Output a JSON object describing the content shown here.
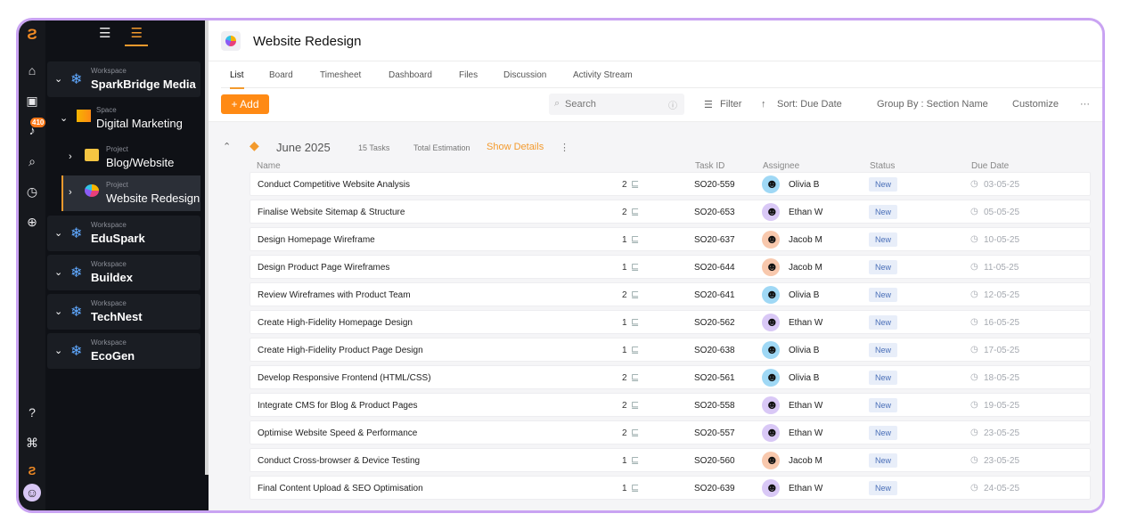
{
  "app": {
    "notifications": "410"
  },
  "sidebar_tabs": {
    "list_icon": "list-icon",
    "tree_icon": "tree-icon"
  },
  "tree": {
    "workspaces": [
      {
        "caption": "Workspace",
        "name": "SparkBridge Media"
      },
      {
        "caption": "Workspace",
        "name": "EduSpark"
      },
      {
        "caption": "Workspace",
        "name": "Buildex"
      },
      {
        "caption": "Workspace",
        "name": "TechNest"
      },
      {
        "caption": "Workspace",
        "name": "EcoGen"
      }
    ],
    "space": {
      "caption": "Space",
      "name": "Digital Marketing"
    },
    "projects": [
      {
        "caption": "Project",
        "name": "Blog/Website"
      },
      {
        "caption": "Project",
        "name": "Website Redesign"
      }
    ]
  },
  "header": {
    "title": "Website Redesign"
  },
  "tabs": [
    "List",
    "Board",
    "Timesheet",
    "Dashboard",
    "Files",
    "Discussion",
    "Activity Stream"
  ],
  "toolbar": {
    "add_label": "+ Add",
    "search_placeholder": "Search",
    "filter": "Filter",
    "sort": "Sort: Due Date",
    "group": "Group By : Section Name",
    "customize": "Customize",
    "more": "···"
  },
  "section": {
    "title": "June 2025",
    "tasks": "15 Tasks",
    "estimation_label": "Total Estimation",
    "details": "Show Details"
  },
  "columns": {
    "name": "Name",
    "task_id": "Task ID",
    "assignee": "Assignee",
    "status": "Status",
    "due": "Due Date"
  },
  "rows": [
    {
      "name": "Conduct Competitive Website Analysis",
      "sub": "2",
      "id": "SO20-559",
      "assignee": "Olivia B",
      "status": "New",
      "due": "03-05-25"
    },
    {
      "name": "Finalise Website Sitemap & Structure",
      "sub": "2",
      "id": "SO20-653",
      "assignee": "Ethan W",
      "status": "New",
      "due": "05-05-25"
    },
    {
      "name": "Design Homepage Wireframe",
      "sub": "1",
      "id": "SO20-637",
      "assignee": "Jacob M",
      "status": "New",
      "due": "10-05-25"
    },
    {
      "name": "Design Product Page Wireframes",
      "sub": "1",
      "id": "SO20-644",
      "assignee": "Jacob M",
      "status": "New",
      "due": "11-05-25"
    },
    {
      "name": "Review Wireframes with Product Team",
      "sub": "2",
      "id": "SO20-641",
      "assignee": "Olivia B",
      "status": "New",
      "due": "12-05-25"
    },
    {
      "name": "Create High-Fidelity Homepage Design",
      "sub": "1",
      "id": "SO20-562",
      "assignee": "Ethan W",
      "status": "New",
      "due": "16-05-25"
    },
    {
      "name": "Create High-Fidelity Product Page Design",
      "sub": "1",
      "id": "SO20-638",
      "assignee": "Olivia B",
      "status": "New",
      "due": "17-05-25"
    },
    {
      "name": "Develop Responsive Frontend (HTML/CSS)",
      "sub": "2",
      "id": "SO20-561",
      "assignee": "Olivia B",
      "status": "New",
      "due": "18-05-25"
    },
    {
      "name": "Integrate CMS for Blog & Product Pages",
      "sub": "2",
      "id": "SO20-558",
      "assignee": "Ethan W",
      "status": "New",
      "due": "19-05-25"
    },
    {
      "name": "Optimise Website Speed & Performance",
      "sub": "2",
      "id": "SO20-557",
      "assignee": "Ethan W",
      "status": "New",
      "due": "23-05-25"
    },
    {
      "name": "Conduct Cross-browser & Device Testing",
      "sub": "1",
      "id": "SO20-560",
      "assignee": "Jacob M",
      "status": "New",
      "due": "23-05-25"
    },
    {
      "name": "Final Content Upload & SEO Optimisation",
      "sub": "1",
      "id": "SO20-639",
      "assignee": "Ethan W",
      "status": "New",
      "due": "24-05-25"
    }
  ],
  "colors": {
    "accent": "#ff8a14",
    "frame": "#c9a3f2",
    "sidebar": "#0f1116",
    "status_bg": "#e8eef9"
  }
}
